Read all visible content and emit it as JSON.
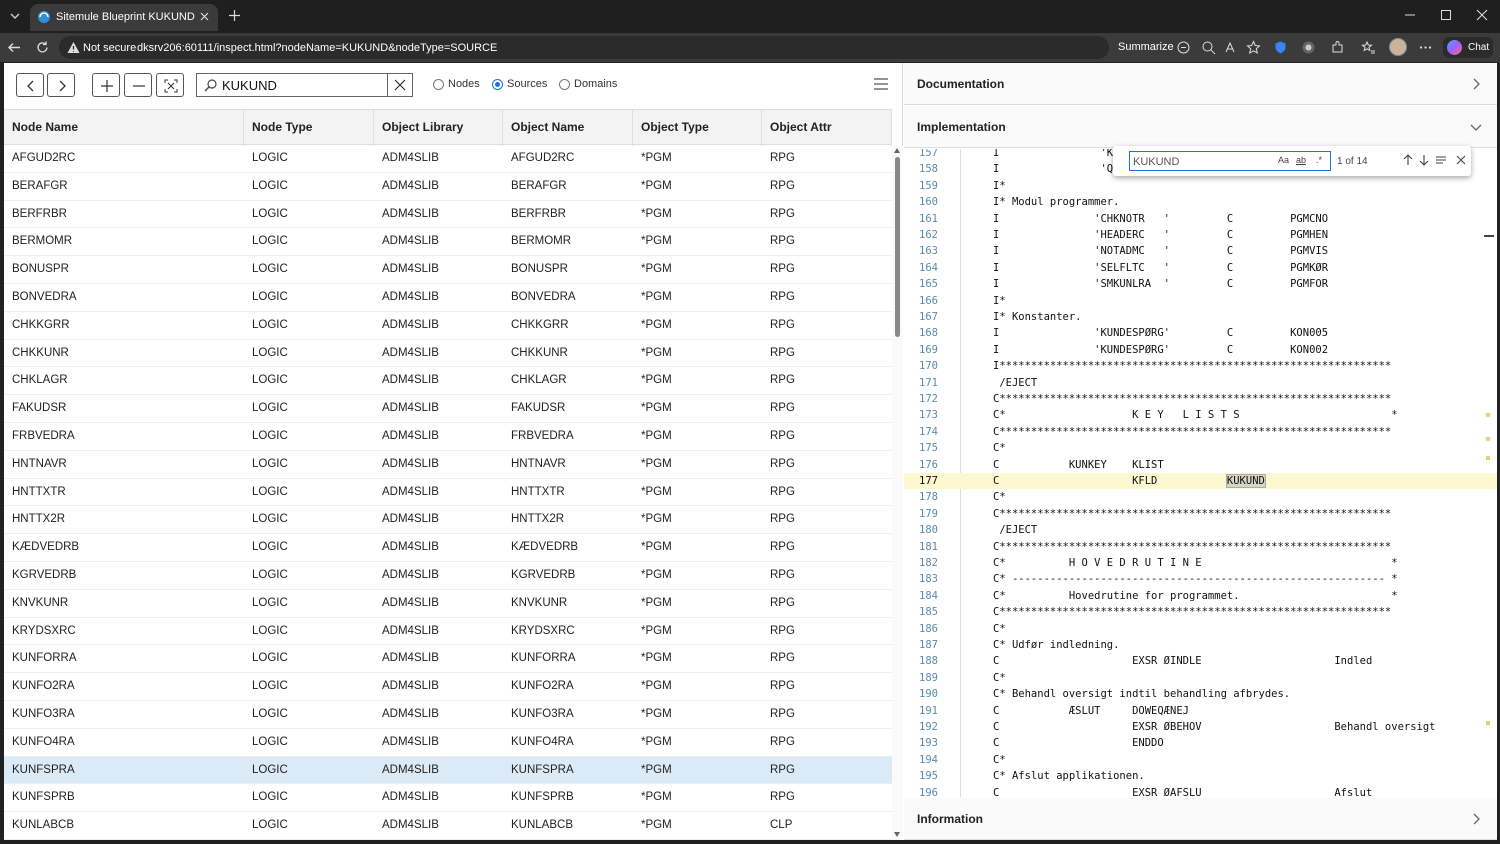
{
  "browser": {
    "tab_title": "Sitemule Blueprint KUKUND",
    "security_label": "Not secure",
    "url": "dksrv206:60111/inspect.html?nodeName=KUKUND&nodeType=SOURCE",
    "summarize_label": "Summarize",
    "chat_label": "Chat"
  },
  "toolbar": {
    "search_value": "KUKUND",
    "radio_nodes": "Nodes",
    "radio_sources": "Sources",
    "radio_domains": "Domains",
    "selected_radio": "Sources"
  },
  "table": {
    "columns": [
      "Node Name",
      "Node Type",
      "Object Library",
      "Object Name",
      "Object Type",
      "Object Attr"
    ],
    "rows": [
      [
        "AFGUD2RC",
        "LOGIC",
        "ADM4SLIB",
        "AFGUD2RC",
        "*PGM",
        "RPG"
      ],
      [
        "BERAFGR",
        "LOGIC",
        "ADM4SLIB",
        "BERAFGR",
        "*PGM",
        "RPG"
      ],
      [
        "BERFRBR",
        "LOGIC",
        "ADM4SLIB",
        "BERFRBR",
        "*PGM",
        "RPG"
      ],
      [
        "BERMOMR",
        "LOGIC",
        "ADM4SLIB",
        "BERMOMR",
        "*PGM",
        "RPG"
      ],
      [
        "BONUSPR",
        "LOGIC",
        "ADM4SLIB",
        "BONUSPR",
        "*PGM",
        "RPG"
      ],
      [
        "BONVEDRA",
        "LOGIC",
        "ADM4SLIB",
        "BONVEDRA",
        "*PGM",
        "RPG"
      ],
      [
        "CHKKGRR",
        "LOGIC",
        "ADM4SLIB",
        "CHKKGRR",
        "*PGM",
        "RPG"
      ],
      [
        "CHKKUNR",
        "LOGIC",
        "ADM4SLIB",
        "CHKKUNR",
        "*PGM",
        "RPG"
      ],
      [
        "CHKLAGR",
        "LOGIC",
        "ADM4SLIB",
        "CHKLAGR",
        "*PGM",
        "RPG"
      ],
      [
        "FAKUDSR",
        "LOGIC",
        "ADM4SLIB",
        "FAKUDSR",
        "*PGM",
        "RPG"
      ],
      [
        "FRBVEDRA",
        "LOGIC",
        "ADM4SLIB",
        "FRBVEDRA",
        "*PGM",
        "RPG"
      ],
      [
        "HNTNAVR",
        "LOGIC",
        "ADM4SLIB",
        "HNTNAVR",
        "*PGM",
        "RPG"
      ],
      [
        "HNTTXTR",
        "LOGIC",
        "ADM4SLIB",
        "HNTTXTR",
        "*PGM",
        "RPG"
      ],
      [
        "HNTTX2R",
        "LOGIC",
        "ADM4SLIB",
        "HNTTX2R",
        "*PGM",
        "RPG"
      ],
      [
        "KÆDVEDRB",
        "LOGIC",
        "ADM4SLIB",
        "KÆDVEDRB",
        "*PGM",
        "RPG"
      ],
      [
        "KGRVEDRB",
        "LOGIC",
        "ADM4SLIB",
        "KGRVEDRB",
        "*PGM",
        "RPG"
      ],
      [
        "KNVKUNR",
        "LOGIC",
        "ADM4SLIB",
        "KNVKUNR",
        "*PGM",
        "RPG"
      ],
      [
        "KRYDSXRC",
        "LOGIC",
        "ADM4SLIB",
        "KRYDSXRC",
        "*PGM",
        "RPG"
      ],
      [
        "KUNFORRA",
        "LOGIC",
        "ADM4SLIB",
        "KUNFORRA",
        "*PGM",
        "RPG"
      ],
      [
        "KUNFO2RA",
        "LOGIC",
        "ADM4SLIB",
        "KUNFO2RA",
        "*PGM",
        "RPG"
      ],
      [
        "KUNFO3RA",
        "LOGIC",
        "ADM4SLIB",
        "KUNFO3RA",
        "*PGM",
        "RPG"
      ],
      [
        "KUNFO4RA",
        "LOGIC",
        "ADM4SLIB",
        "KUNFO4RA",
        "*PGM",
        "RPG"
      ],
      [
        "KUNFSPRA",
        "LOGIC",
        "ADM4SLIB",
        "KUNFSPRA",
        "*PGM",
        "RPG"
      ],
      [
        "KUNFSPRB",
        "LOGIC",
        "ADM4SLIB",
        "KUNFSPRB",
        "*PGM",
        "RPG"
      ],
      [
        "KUNLABCB",
        "LOGIC",
        "ADM4SLIB",
        "KUNLABCB",
        "*PGM",
        "CLP"
      ]
    ],
    "selected_row": "KUNFSPRA"
  },
  "right": {
    "documentation": "Documentation",
    "implementation": "Implementation",
    "information": "Information",
    "find": {
      "value": "KUKUND",
      "count": "1 of 14",
      "opt_case": "Aa",
      "opt_word": "ab",
      "opt_regex": ".*"
    },
    "current_line": "177",
    "highlight_term": "KUKUND",
    "code": [
      {
        "n": "157",
        "t": "I                'KU"
      },
      {
        "n": "158",
        "t": "I                'Q2"
      },
      {
        "n": "159",
        "t": "I*"
      },
      {
        "n": "160",
        "t": "I* Modul programmer."
      },
      {
        "n": "161",
        "t": "I               'CHKNOTR   '         C         PGMCNO"
      },
      {
        "n": "162",
        "t": "I               'HEADERC   '         C         PGMHEN"
      },
      {
        "n": "163",
        "t": "I               'NOTADMC   '         C         PGMVIS"
      },
      {
        "n": "164",
        "t": "I               'SELFLTC   '         C         PGMKØR"
      },
      {
        "n": "165",
        "t": "I               'SMKUNLRA  '         C         PGMFOR"
      },
      {
        "n": "166",
        "t": "I*"
      },
      {
        "n": "167",
        "t": "I* Konstanter."
      },
      {
        "n": "168",
        "t": "I               'KUNDESPØRG'         C         KON005"
      },
      {
        "n": "169",
        "t": "I               'KUNDESPØRG'         C         KON002"
      },
      {
        "n": "170",
        "t": "I**************************************************************"
      },
      {
        "n": "171",
        "t": " /EJECT"
      },
      {
        "n": "172",
        "t": "C**************************************************************"
      },
      {
        "n": "173",
        "t": "C*                    K E Y   L I S T S                        *"
      },
      {
        "n": "174",
        "t": "C**************************************************************"
      },
      {
        "n": "175",
        "t": "C*"
      },
      {
        "n": "176",
        "t": "C           KUNKEY    KLIST"
      },
      {
        "n": "177",
        "t": "C                     KFLD           ",
        "m": "KUKUND"
      },
      {
        "n": "178",
        "t": "C*"
      },
      {
        "n": "179",
        "t": "C**************************************************************"
      },
      {
        "n": "180",
        "t": " /EJECT"
      },
      {
        "n": "181",
        "t": "C**************************************************************"
      },
      {
        "n": "182",
        "t": "C*          H O V E D R U T I N E                              *"
      },
      {
        "n": "183",
        "t": "C* ----------------------------------------------------------- *"
      },
      {
        "n": "184",
        "t": "C*          Hovedrutine for programmet.                        *"
      },
      {
        "n": "185",
        "t": "C**************************************************************"
      },
      {
        "n": "186",
        "t": "C*"
      },
      {
        "n": "187",
        "t": "C* Udfør indledning."
      },
      {
        "n": "188",
        "t": "C                     EXSR ØINDLE                     Indled"
      },
      {
        "n": "189",
        "t": "C*"
      },
      {
        "n": "190",
        "t": "C* Behandl oversigt indtil behandling afbrydes."
      },
      {
        "n": "191",
        "t": "C           ÆSLUT     DOWEQÆNEJ"
      },
      {
        "n": "192",
        "t": "C                     EXSR ØBEHOV                     Behandl oversigt"
      },
      {
        "n": "193",
        "t": "C                     ENDDO"
      },
      {
        "n": "194",
        "t": "C*"
      },
      {
        "n": "195",
        "t": "C* Afslut applikationen."
      },
      {
        "n": "196",
        "t": "C                     EXSR ØAFSLU                     Afslut"
      }
    ]
  },
  "colors": {
    "accent": "#1a73e8",
    "selected_row": "#dbeaf7",
    "current_line": "#fdf8cf",
    "line_number": "#5a8ca8"
  }
}
